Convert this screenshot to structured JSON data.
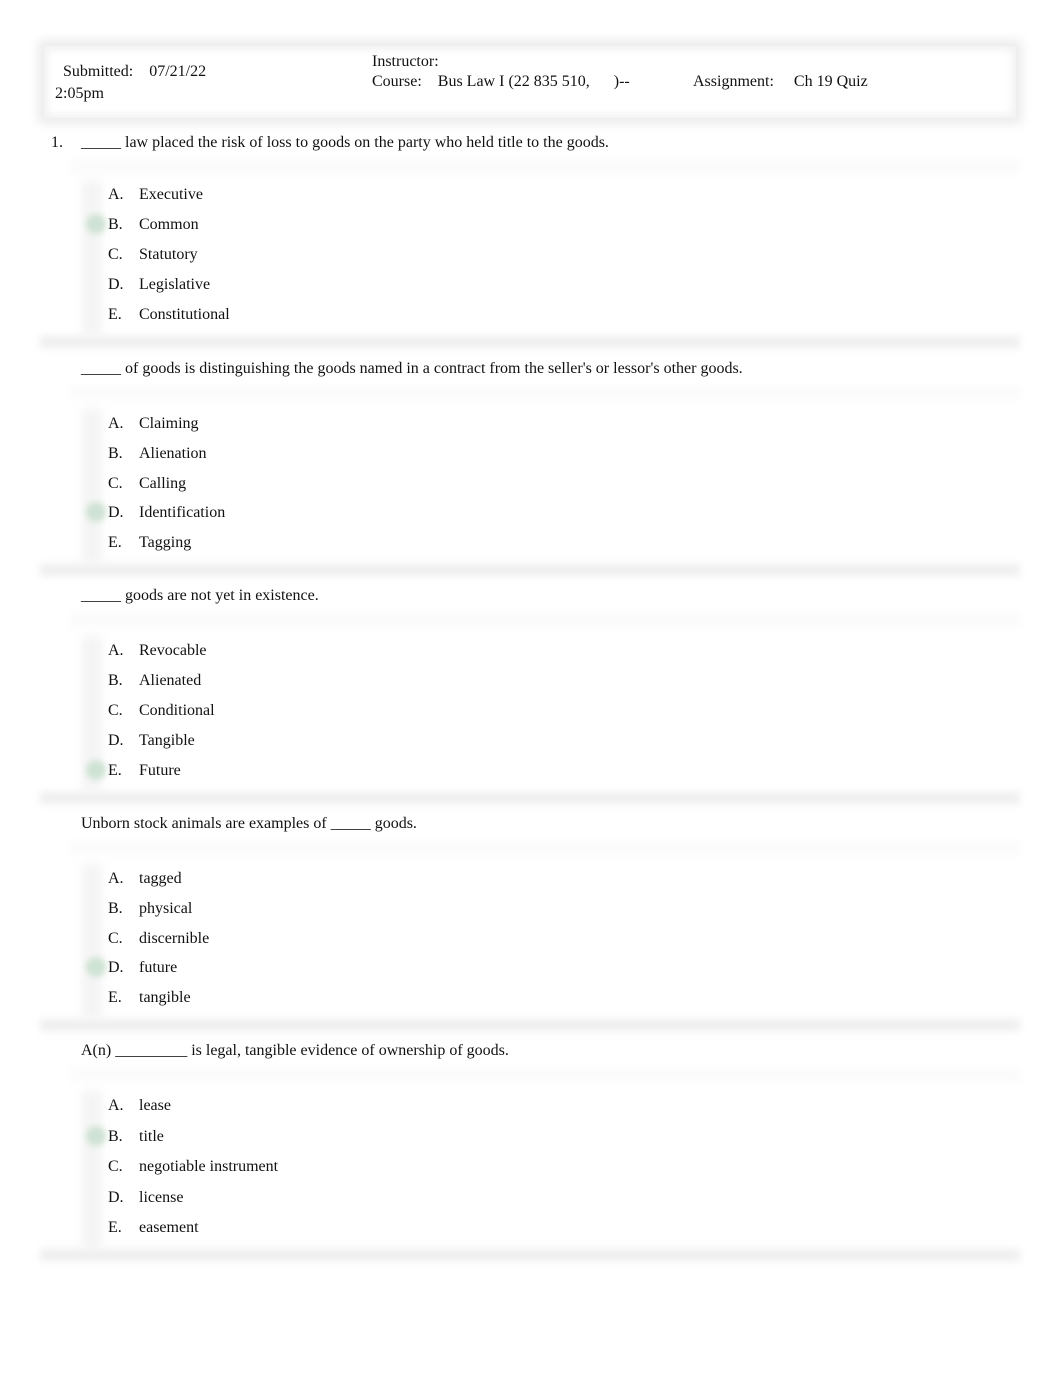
{
  "header": {
    "submitted_label": "Submitted:",
    "submitted_date": "07/21/22",
    "submitted_time": "2:05pm",
    "instructor_label": "Instructor:",
    "instructor_value": "",
    "course_label": "Course:",
    "course_value": "Bus Law I (22 835 510,      )--",
    "assignment_label": "Assignment:",
    "assignment_value": "Ch 19 Quiz"
  },
  "colors": {
    "correct_marker": "#cfe3d4",
    "divider": "#eeeeee"
  },
  "questions": [
    {
      "number": "1.",
      "text": "_____ law placed the risk of loss to goods on the party who held title to the goods.",
      "correct": "B",
      "options": [
        {
          "letter": "A.",
          "text": "Executive"
        },
        {
          "letter": "B.",
          "text": "Common"
        },
        {
          "letter": "C.",
          "text": "Statutory"
        },
        {
          "letter": "D.",
          "text": "Legislative"
        },
        {
          "letter": "E.",
          "text": "Constitutional"
        }
      ]
    },
    {
      "number": "",
      "text": "_____ of goods is distinguishing the goods named in a contract from the seller's or lessor's other goods.",
      "correct": "D",
      "options": [
        {
          "letter": "A.",
          "text": "Claiming"
        },
        {
          "letter": "B.",
          "text": "Alienation"
        },
        {
          "letter": "C.",
          "text": "Calling"
        },
        {
          "letter": "D.",
          "text": "Identification"
        },
        {
          "letter": "E.",
          "text": "Tagging"
        }
      ]
    },
    {
      "number": "",
      "text": "_____ goods are not yet in existence.",
      "correct": "E",
      "options": [
        {
          "letter": "A.",
          "text": "Revocable"
        },
        {
          "letter": "B.",
          "text": "Alienated"
        },
        {
          "letter": "C.",
          "text": "Conditional"
        },
        {
          "letter": "D.",
          "text": "Tangible"
        },
        {
          "letter": "E.",
          "text": "Future"
        }
      ]
    },
    {
      "number": "",
      "text": "Unborn stock animals are examples of _____ goods.",
      "correct": "D",
      "options": [
        {
          "letter": "A.",
          "text": "tagged"
        },
        {
          "letter": "B.",
          "text": "physical"
        },
        {
          "letter": "C.",
          "text": "discernible"
        },
        {
          "letter": "D.",
          "text": "future"
        },
        {
          "letter": "E.",
          "text": "tangible"
        }
      ]
    },
    {
      "number": "",
      "text": "A(n) _________ is legal, tangible evidence of ownership of goods.",
      "correct": "B",
      "options": [
        {
          "letter": "A.",
          "text": "lease"
        },
        {
          "letter": "B.",
          "text": "title"
        },
        {
          "letter": "C.",
          "text": "negotiable instrument"
        },
        {
          "letter": "D.",
          "text": "license"
        },
        {
          "letter": "E.",
          "text": "easement"
        }
      ]
    }
  ]
}
